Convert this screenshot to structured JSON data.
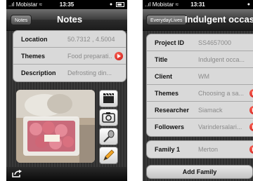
{
  "left_screen": {
    "status": {
      "carrier": "Mobistar",
      "time": "13:35"
    },
    "nav": {
      "back_label": "Notes",
      "title": "Notes"
    },
    "fields": [
      {
        "label": "Location",
        "value": "50.7312 , 4.5004"
      },
      {
        "label": "Themes",
        "value": "Food preparati...",
        "has_disclosure": true
      },
      {
        "label": "Description",
        "value": "Defrosting din..."
      }
    ],
    "media_buttons": [
      "clapperboard-icon",
      "camera-icon",
      "microphone-icon",
      "pencil-icon"
    ],
    "toolbar": {
      "share_icon": "share-icon"
    }
  },
  "right_screen": {
    "status": {
      "carrier": "Mobistar",
      "time": "13:31"
    },
    "nav": {
      "back_label": "EverydayLives",
      "title": "Indulgent occasion"
    },
    "fields": [
      {
        "label": "Project ID",
        "value": "SS4657000"
      },
      {
        "label": "Title",
        "value": "Indulgent occa..."
      },
      {
        "label": "Client",
        "value": "WM"
      },
      {
        "label": "Themes",
        "value": "Choosing a sa...",
        "has_disclosure": true
      },
      {
        "label": "Researcher",
        "value": "Siamack",
        "has_disclosure": true
      },
      {
        "label": "Followers",
        "value": "Varindersalari...",
        "has_disclosure": true
      }
    ],
    "family": {
      "label": "Family 1",
      "value": "Merton",
      "has_disclosure": true
    },
    "add_family_label": "Add Family"
  },
  "colors": {
    "disclosure_red": "#d21e1e",
    "nav_dark": "#2c2c2c",
    "cell_bg": "#d9d9d9"
  }
}
